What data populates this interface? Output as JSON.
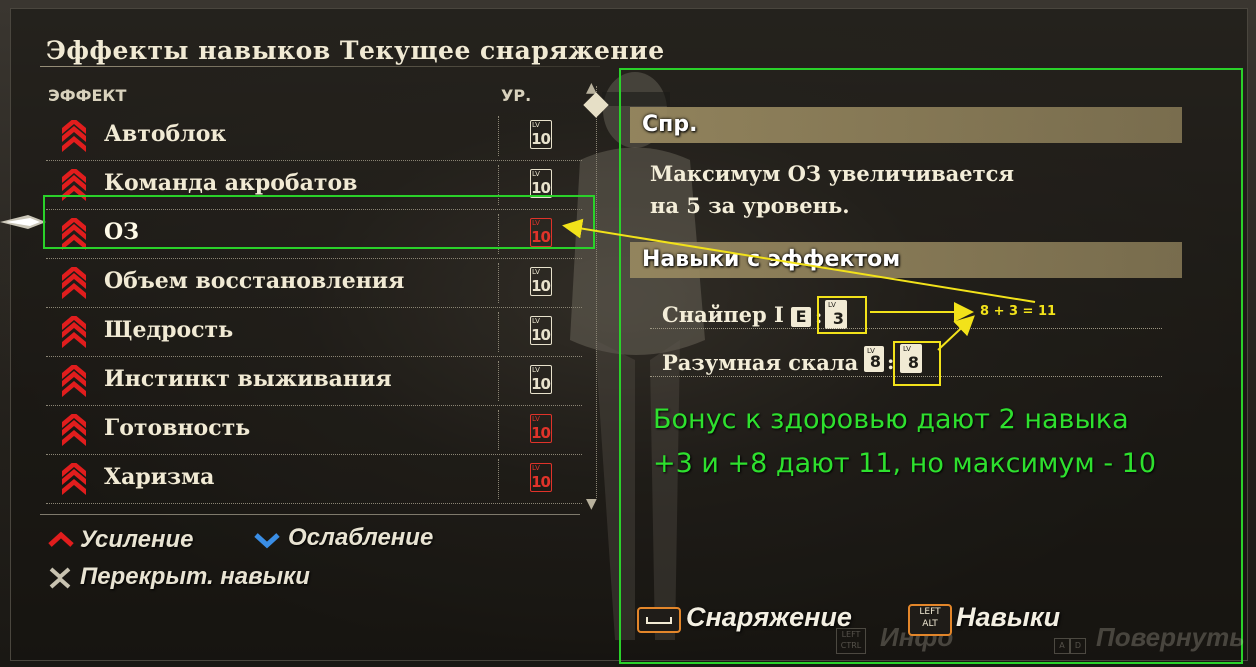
{
  "title": "Эффекты навыков Текущее снаряжение",
  "columns": {
    "effect": "ЭФФЕКТ",
    "level": "УР."
  },
  "effects": [
    {
      "name": "Автоблок",
      "lv_tag": "LV",
      "level": "10",
      "color": "#e8e2cc"
    },
    {
      "name": "Команда акробатов",
      "lv_tag": "LV",
      "level": "10",
      "color": "#e8e2cc"
    },
    {
      "name": "ОЗ",
      "lv_tag": "LV",
      "level": "10",
      "color": "#e0332a"
    },
    {
      "name": "Объем восстановления",
      "lv_tag": "LV",
      "level": "10",
      "color": "#e8e2cc"
    },
    {
      "name": "Щедрость",
      "lv_tag": "LV",
      "level": "10",
      "color": "#e8e2cc"
    },
    {
      "name": "Инстинкт выживания",
      "lv_tag": "LV",
      "level": "10",
      "color": "#e8e2cc"
    },
    {
      "name": "Готовность",
      "lv_tag": "LV",
      "level": "10",
      "color": "#e0332a"
    },
    {
      "name": "Харизма",
      "lv_tag": "LV",
      "level": "10",
      "color": "#e0332a"
    }
  ],
  "legend": {
    "boost": "Усиление",
    "weaken": "Ослабление",
    "overlap": "Перекрыт. навыки"
  },
  "detail": {
    "header": "Спр.",
    "description_line1": "Максимум ОЗ увеличивается",
    "description_line2": "на 5 за уровень.",
    "skills_header": "Навыки с эффектом",
    "skills": [
      {
        "name": "Снайпер I",
        "badge": "E",
        "lv_tag": "LV",
        "level": "3"
      },
      {
        "name": "Разумная скала",
        "lv_tag": "LV",
        "badge_level": "8",
        "level": "8"
      }
    ]
  },
  "annotation": {
    "sum": "8 + 3 = 11",
    "note_line1": "Бонус к здоровью дают 2 навыка",
    "note_line2": "+3 и +8 дают 11, но максимум - 10"
  },
  "bottom": {
    "equipment_label": "Снаряжение",
    "skills_key_top": "LEFT",
    "skills_key_bottom": "ALT",
    "skills_label": "Навыки",
    "info_key_top": "LEFT",
    "info_key_bottom": "CTRL",
    "info_label": "Инфо",
    "rotate_key_left": "A",
    "rotate_key_right": "D",
    "rotate_label": "Повернуть"
  },
  "colors": {
    "annotation_green": "#2ad12a",
    "annotation_yellow": "#f2e21a",
    "level_max_red": "#e0332a",
    "boost_red": "#e11d1d",
    "weaken_blue": "#3a8ee6"
  }
}
